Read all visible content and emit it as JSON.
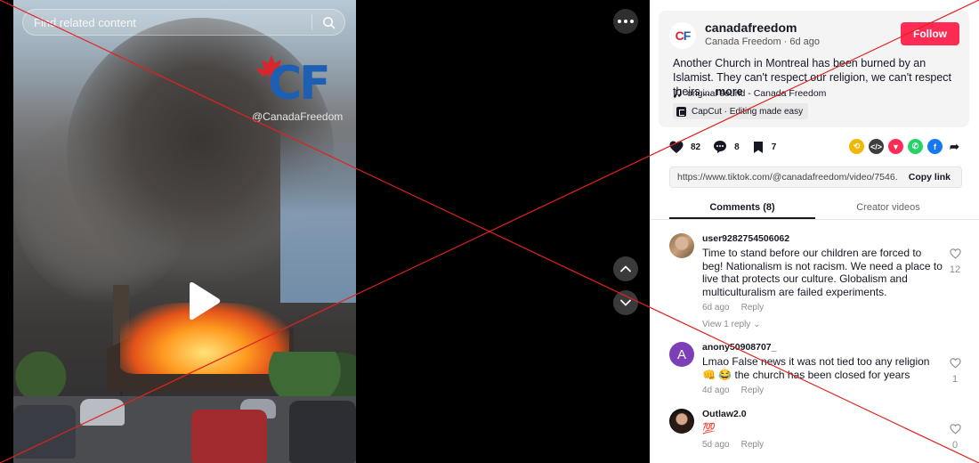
{
  "search": {
    "placeholder": "Find related content"
  },
  "video": {
    "watermark_handle": "@CanadaFreedom",
    "logo_text": "CF"
  },
  "author": {
    "username": "canadafreedom",
    "nickname": "Canada Freedom",
    "posted": "6d ago",
    "follow_label": "Follow",
    "avatar_text_red": "C",
    "avatar_text_blue": "F"
  },
  "post": {
    "description": "Another Church in Montreal has been burned by an Islamist. They can't respect our religion, we can't respect theirs....",
    "more_label": "more",
    "sound": "original sound - Canada Freedom",
    "capcut": "CapCut · Editing made easy"
  },
  "stats": {
    "likes": "82",
    "comments": "8",
    "saves": "7"
  },
  "link": {
    "url": "https://www.tiktok.com/@canadafreedom/video/7546...",
    "copy_label": "Copy link"
  },
  "tabs": [
    {
      "label": "Comments (8)",
      "active": true
    },
    {
      "label": "Creator videos",
      "active": false
    }
  ],
  "comments": [
    {
      "user": "user9282754506062",
      "text": "Time to stand before our children are forced to beg! Nationalism is not racism. We need a place to live that protects our culture. Globalism and multiculturalism are failed experiments.",
      "time": "6d ago",
      "reply_label": "Reply",
      "view_replies": "View 1 reply ⌄",
      "likes": "12"
    },
    {
      "user": "anony50908707_",
      "avatar_letter": "A",
      "text": "Lmao False news it was not tied too any religion 👊 😂 the church has been closed for years",
      "time": "4d ago",
      "reply_label": "Reply",
      "likes": "1"
    },
    {
      "user": "Outlaw2.0",
      "text": "💯",
      "time": "5d ago",
      "reply_label": "Reply",
      "likes": "0"
    }
  ],
  "colors": {
    "accent": "#fe2c55",
    "overlay_x": "#e0221c"
  }
}
